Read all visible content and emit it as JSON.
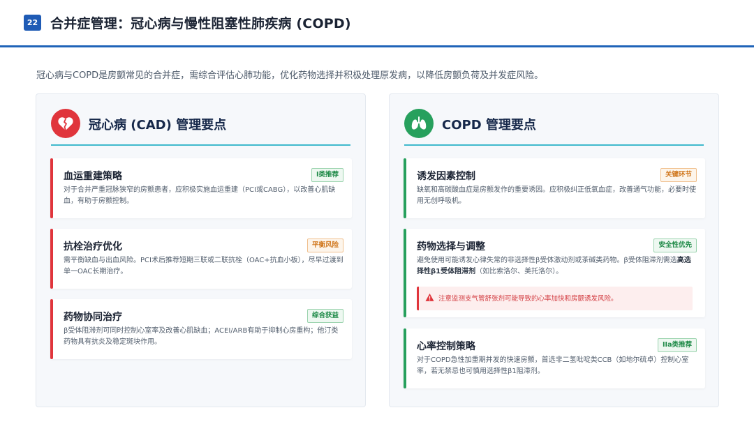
{
  "header": {
    "page_number": "22",
    "title": "合并症管理：冠心病与慢性阻塞性肺疾病 (COPD)"
  },
  "intro": "冠心病与COPD是房颤常见的合并症，需综合评估心肺功能，优化药物选择并积极处理原发病，以降低房颤负荷及并发症风险。",
  "left_panel": {
    "icon": "broken-heart-icon",
    "title": "冠心病 (CAD) 管理要点",
    "cards": [
      {
        "title": "血运重建策略",
        "badge": "I类推荐",
        "body": "对于合并严重冠脉狭窄的房颤患者，应积极实施血运重建（PCI或CABG），以改善心肌缺血，有助于房颤控制。"
      },
      {
        "title": "抗栓治疗优化",
        "badge": "平衡风险",
        "body": "需平衡缺血与出血风险。PCI术后推荐短期三联或二联抗栓（OAC+抗血小板），尽早过渡到单一OAC长期治疗。"
      },
      {
        "title": "药物协同治疗",
        "badge": "综合获益",
        "body": "β受体阻滞剂可同时控制心室率及改善心肌缺血；ACEI/ARB有助于抑制心房重构；他汀类药物具有抗炎及稳定斑块作用。"
      }
    ]
  },
  "right_panel": {
    "icon": "lungs-icon",
    "title": "COPD 管理要点",
    "cards": [
      {
        "title": "诱发因素控制",
        "badge": "关键环节",
        "body": "缺氧和高碳酸血症是房颤发作的重要诱因。应积极纠正低氧血症，改善通气功能，必要时使用无创呼吸机。"
      },
      {
        "title": "药物选择与调整",
        "badge": "安全性优先",
        "body_pre": "避免使用可能诱发心律失常的非选择性β受体激动剂或茶碱类药物。β受体阻滞剂需选",
        "body_bold": "高选择性β1受体阻滞剂",
        "body_post": "（如比索洛尔、美托洛尔）。",
        "warning": "注意监测支气管舒张剂可能导致的心率加快和房颤诱发风险。"
      },
      {
        "title": "心率控制策略",
        "badge": "IIa类推荐",
        "body": "对于COPD急性加重期并发的快速房颤，首选非二氢吡啶类CCB（如地尔硫卓）控制心室率，若无禁忌也可慎用选择性β1阻滞剂。"
      }
    ]
  },
  "colors": {
    "accent_blue": "#1f63b8",
    "red": "#e0353c",
    "green": "#27a05d",
    "orange": "#d0761b",
    "teal_rule": "#3fb9cc"
  }
}
